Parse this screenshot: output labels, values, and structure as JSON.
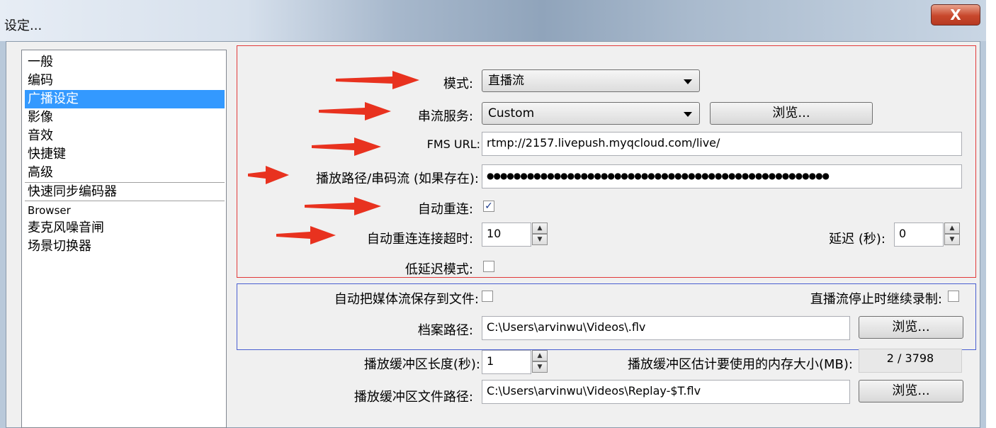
{
  "window": {
    "title": "设定...",
    "close_label": "X"
  },
  "sidebar": {
    "items": [
      {
        "label": "一般"
      },
      {
        "label": "编码"
      },
      {
        "label": "广播设定"
      },
      {
        "label": "影像"
      },
      {
        "label": "音效"
      },
      {
        "label": "快捷键"
      },
      {
        "label": "高级"
      },
      {
        "label": "快速同步编码器"
      },
      {
        "label": "Browser"
      },
      {
        "label": "麦克风噪音闸"
      },
      {
        "label": "场景切换器"
      }
    ]
  },
  "broadcast": {
    "mode_label": "模式:",
    "mode_value": "直播流",
    "service_label": "串流服务:",
    "service_value": "Custom",
    "browse_label": "浏览...",
    "fms_url_label": "FMS URL:",
    "fms_url_value": "rtmp://2157.livepush.myqcloud.com/live/",
    "stream_key_label": "播放路径/串码流 (如果存在):",
    "stream_key_value": "●●●●●●●●●●●●●●●●●●●●●●●●●●●●●●●●●●●●●●●●●●●●●●●●●●●",
    "auto_reconnect_label": "自动重连:",
    "auto_reconnect_checked": "✓",
    "reconnect_timeout_label": "自动重连连接超时:",
    "reconnect_timeout_value": "10",
    "delay_label": "延迟 (秒):",
    "delay_value": "0",
    "low_latency_label": "低延迟模式:"
  },
  "recording": {
    "auto_save_label": "自动把媒体流保存到文件:",
    "keep_recording_label": "直播流停止时继续录制:",
    "file_path_label": "档案路径:",
    "file_path_value": "C:\\Users\\arvinwu\\Videos\\.flv",
    "browse_label": "浏览..."
  },
  "replay": {
    "buffer_length_label": "播放缓冲区长度(秒):",
    "buffer_length_value": "1",
    "memory_label": "播放缓冲区估计要使用的内存大小(MB):",
    "memory_value": "2 / 3798",
    "buffer_path_label": "播放缓冲区文件路径:",
    "buffer_path_value": "C:\\Users\\arvinwu\\Videos\\Replay-$T.flv",
    "browse_label": "浏览..."
  },
  "colors": {
    "highlight": "#3399ff",
    "red_frame": "#e23a3a",
    "blue_frame": "#4a5fd1",
    "arrow": "#e8321f"
  }
}
